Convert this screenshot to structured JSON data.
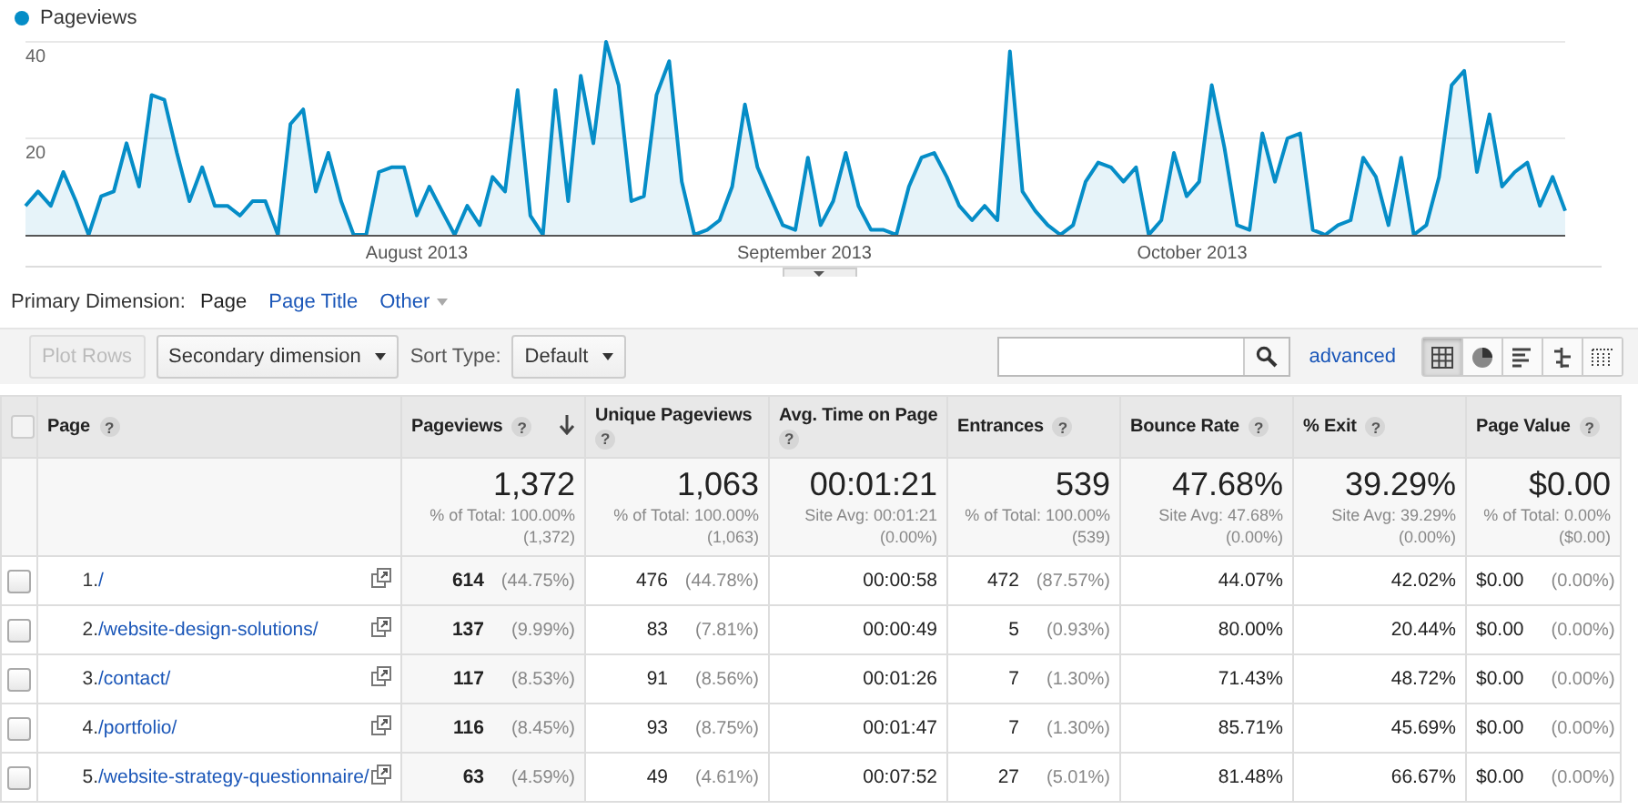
{
  "chart": {
    "chart_data": {
      "type": "area",
      "series": [
        {
          "name": "Pageviews",
          "color": "#058dc7",
          "values": [
            6,
            9,
            6,
            13,
            7,
            0,
            8,
            9,
            19,
            10,
            29,
            28,
            17,
            7,
            14,
            6,
            6,
            4,
            7,
            7,
            0,
            23,
            26,
            9,
            17,
            7,
            0,
            0,
            13,
            14,
            14,
            4,
            10,
            5,
            0,
            6,
            2,
            12,
            9,
            30,
            4,
            0,
            30,
            7,
            33,
            19,
            40,
            31,
            7,
            8,
            29,
            36,
            11,
            0,
            1,
            3,
            10,
            27,
            14,
            8,
            2,
            1,
            16,
            2,
            7,
            17,
            6,
            1,
            1,
            0,
            10,
            16,
            17,
            12,
            6,
            3,
            6,
            3,
            38,
            9,
            5,
            2,
            0,
            2,
            11,
            15,
            14,
            11,
            14,
            0,
            3,
            17,
            8,
            11,
            31,
            18,
            2,
            1,
            21,
            11,
            20,
            21,
            1,
            0,
            2,
            3,
            16,
            12,
            2,
            16,
            0,
            2,
            12,
            31,
            34,
            13,
            25,
            10,
            13,
            15,
            6,
            12,
            5
          ]
        }
      ],
      "yticks": [
        20,
        40
      ],
      "ylim": [
        0,
        40
      ]
    },
    "x_axis_labels": [
      "August 2013",
      "September 2013",
      "October 2013"
    ]
  },
  "primary_dimension": {
    "label": "Primary Dimension:",
    "options": [
      {
        "label": "Page",
        "selected": true,
        "kind": "link"
      },
      {
        "label": "Page Title",
        "selected": false,
        "kind": "link"
      },
      {
        "label": "Other",
        "selected": false,
        "kind": "dropdown"
      }
    ]
  },
  "toolbar": {
    "plot_rows": {
      "label": "Plot Rows",
      "disabled": true
    },
    "secondary_dimension": "Secondary dimension",
    "sort_type_label": "Sort Type:",
    "sort_type": "Default",
    "advanced_link": "advanced",
    "views": [
      {
        "kind": "table",
        "selected": true
      },
      {
        "kind": "pie",
        "selected": false
      },
      {
        "kind": "bars",
        "selected": false
      },
      {
        "kind": "comparison",
        "selected": false
      },
      {
        "kind": "pivot",
        "selected": false
      }
    ]
  },
  "table": {
    "select_all_checked": false,
    "columns": [
      {
        "label": "Page",
        "help": "?",
        "sorted": false
      },
      {
        "label": "Pageviews",
        "help": "?",
        "sorted": true
      },
      {
        "label": "Unique Pageviews",
        "help": "?",
        "sorted": false
      },
      {
        "label": "Avg. Time on Page",
        "help": "?",
        "sorted": false
      },
      {
        "label": "Entrances",
        "help": "?",
        "sorted": false
      },
      {
        "label": "Bounce Rate",
        "help": "?",
        "sorted": false
      },
      {
        "label": "% Exit",
        "help": "?",
        "sorted": false
      },
      {
        "label": "Page Value",
        "help": "?",
        "sorted": false
      }
    ],
    "totals": [
      {
        "value": "1,372",
        "share": "% of Total: 100.00%",
        "base": "(1,372)"
      },
      {
        "value": "1,063",
        "share": "% of Total: 100.00%",
        "base": "(1,063)"
      },
      {
        "value": "00:01:21",
        "share": "Site Avg: 00:01:21",
        "base": "(0.00%)"
      },
      {
        "value": "539",
        "share": "% of Total: 100.00%",
        "base": "(539)"
      },
      {
        "value": "47.68%",
        "share": "Site Avg: 47.68%",
        "base": "(0.00%)"
      },
      {
        "value": "39.29%",
        "share": "Site Avg: 39.29%",
        "base": "(0.00%)"
      },
      {
        "value": "$0.00",
        "share": "% of Total: 0.00%",
        "base": "($0.00)"
      }
    ],
    "rows": [
      {
        "checked": false,
        "cells": [
          {
            "kind": "page",
            "index": "1.",
            "page": "/"
          },
          {
            "value": "614",
            "pct": "(44.75%)"
          },
          {
            "value": "476",
            "pct": "(44.78%)"
          },
          {
            "value": "00:00:58"
          },
          {
            "value": "472",
            "pct": "(87.57%)"
          },
          {
            "value": "44.07%"
          },
          {
            "value": "42.02%"
          },
          {
            "value": "$0.00",
            "pct": "(0.00%)"
          }
        ]
      },
      {
        "checked": false,
        "cells": [
          {
            "kind": "page",
            "index": "2.",
            "page": "/website-design-solutions/"
          },
          {
            "value": "137",
            "pct": "(9.99%)"
          },
          {
            "value": "83",
            "pct": "(7.81%)"
          },
          {
            "value": "00:00:49"
          },
          {
            "value": "5",
            "pct": "(0.93%)"
          },
          {
            "value": "80.00%"
          },
          {
            "value": "20.44%"
          },
          {
            "value": "$0.00",
            "pct": "(0.00%)"
          }
        ]
      },
      {
        "checked": false,
        "cells": [
          {
            "kind": "page",
            "index": "3.",
            "page": "/contact/"
          },
          {
            "value": "117",
            "pct": "(8.53%)"
          },
          {
            "value": "91",
            "pct": "(8.56%)"
          },
          {
            "value": "00:01:26"
          },
          {
            "value": "7",
            "pct": "(1.30%)"
          },
          {
            "value": "71.43%"
          },
          {
            "value": "48.72%"
          },
          {
            "value": "$0.00",
            "pct": "(0.00%)"
          }
        ]
      },
      {
        "checked": false,
        "cells": [
          {
            "kind": "page",
            "index": "4.",
            "page": "/portfolio/"
          },
          {
            "value": "116",
            "pct": "(8.45%)"
          },
          {
            "value": "93",
            "pct": "(8.75%)"
          },
          {
            "value": "00:01:47"
          },
          {
            "value": "7",
            "pct": "(1.30%)"
          },
          {
            "value": "85.71%"
          },
          {
            "value": "45.69%"
          },
          {
            "value": "$0.00",
            "pct": "(0.00%)"
          }
        ]
      },
      {
        "checked": false,
        "cells": [
          {
            "kind": "page",
            "index": "5.",
            "page": "/website-strategy-questionnaire/"
          },
          {
            "value": "63",
            "pct": "(4.59%)"
          },
          {
            "value": "49",
            "pct": "(4.61%)"
          },
          {
            "value": "00:07:52"
          },
          {
            "value": "27",
            "pct": "(5.01%)"
          },
          {
            "value": "81.48%"
          },
          {
            "value": "66.67%"
          },
          {
            "value": "$0.00",
            "pct": "(0.00%)"
          }
        ]
      }
    ]
  }
}
